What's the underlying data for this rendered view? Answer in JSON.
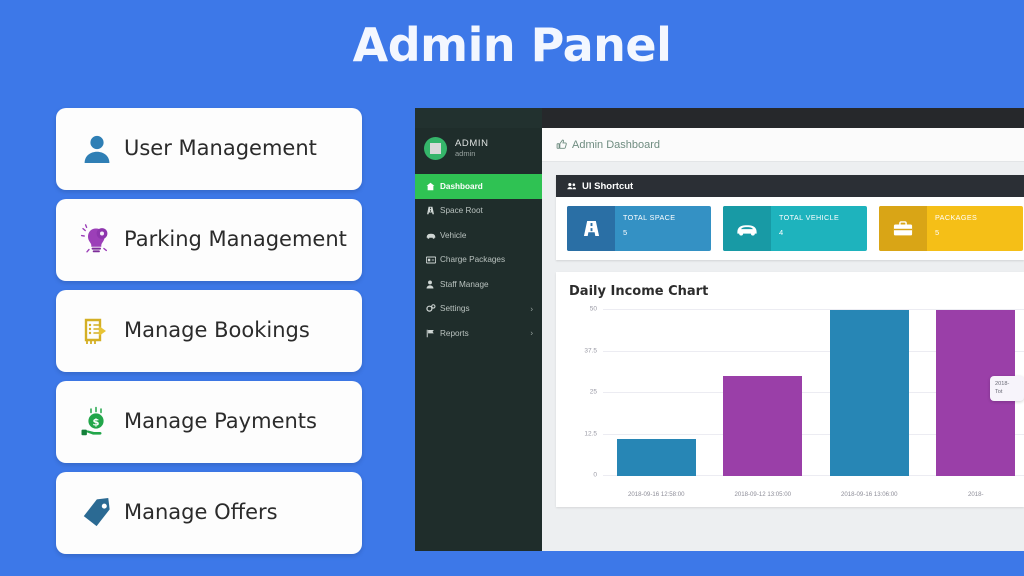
{
  "header": {
    "title": "Admin Panel"
  },
  "theme": {
    "background": "#3d78e8",
    "card_bg": "#fdfdfd",
    "sidebar_bg": "#1f2d2b",
    "active_green": "#2fc253"
  },
  "features": [
    {
      "label": "User Management",
      "icon": "user-icon",
      "color": "#2f7fb5"
    },
    {
      "label": "Parking Management",
      "icon": "lightbulb-gear-icon",
      "color": "#8e3fa8"
    },
    {
      "label": "Manage Bookings",
      "icon": "booking-document-icon",
      "color": "#d4af24"
    },
    {
      "label": "Manage Payments",
      "icon": "money-hand-icon",
      "color": "#22a64a"
    },
    {
      "label": "Manage Offers",
      "icon": "price-tag-icon",
      "color": "#2b6a93"
    }
  ],
  "dashboard": {
    "sidebar": {
      "profile": {
        "name": "ADMIN",
        "role": "admin",
        "avatar": "admin-avatar"
      },
      "items": [
        {
          "label": "Dashboard",
          "icon": "home-icon",
          "active": true,
          "chevron": false
        },
        {
          "label": "Space Root",
          "icon": "road-icon",
          "active": false,
          "chevron": false
        },
        {
          "label": "Vehicle",
          "icon": "car-icon",
          "active": false,
          "chevron": false
        },
        {
          "label": "Charge Packages",
          "icon": "card-icon",
          "active": false,
          "chevron": false
        },
        {
          "label": "Staff Manage",
          "icon": "person-icon",
          "active": false,
          "chevron": false
        },
        {
          "label": "Settings",
          "icon": "gears-icon",
          "active": false,
          "chevron": true
        },
        {
          "label": "Reports",
          "icon": "flag-icon",
          "active": false,
          "chevron": true
        }
      ],
      "chevron_glyph": "›"
    },
    "breadcrumb": {
      "label": "Admin Dashboard",
      "icon": "thumbs-up-icon"
    },
    "shortcut_panel": {
      "title": "UI Shortcut",
      "icon": "users-icon",
      "stats": [
        {
          "label": "TOTAL SPACE",
          "value": "5",
          "icon": "road-icon",
          "icon_bg": "#2a6fa5",
          "body_bg": "#3491c4"
        },
        {
          "label": "TOTAL VEHICLE",
          "value": "4",
          "icon": "car-icon",
          "icon_bg": "#189aa5",
          "body_bg": "#1eb3bd"
        },
        {
          "label": "PACKAGES",
          "value": "5",
          "icon": "briefcase-icon",
          "icon_bg": "#d9a516",
          "body_bg": "#f5bf17"
        },
        {
          "label": "",
          "value": "",
          "icon": "user-circle-icon",
          "icon_bg": "#cf2543",
          "body_bg": "#cf2543"
        }
      ]
    },
    "chart_panel": {
      "title": "Daily Income Chart"
    },
    "tooltip": {
      "line1": "2018-",
      "line2": "Tot"
    }
  },
  "chart_data": {
    "type": "bar",
    "title": "Daily Income Chart",
    "xlabel": "",
    "ylabel": "",
    "ylim": [
      0,
      50
    ],
    "yticks": [
      "0",
      "12.5",
      "25",
      "37.5",
      "50"
    ],
    "ytick_values": [
      0,
      12.5,
      25,
      37.5,
      50
    ],
    "grid": true,
    "legend": false,
    "categories": [
      "2018-09-16 12:58:00",
      "2018-09-12 13:05:00",
      "2018-09-16 13:06:00",
      "2018-"
    ],
    "values": [
      11,
      30,
      50,
      50
    ],
    "colors": [
      "#2786b5",
      "#9a3fa8",
      "#2786b5",
      "#9a3fa8"
    ]
  }
}
